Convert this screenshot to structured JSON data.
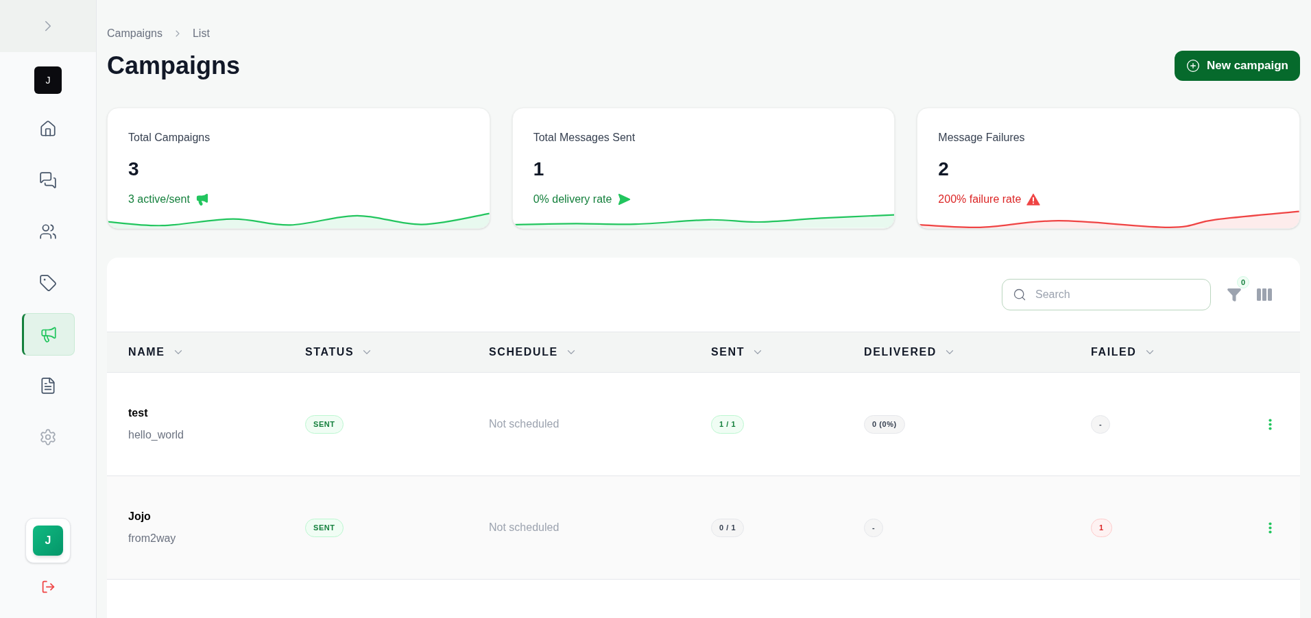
{
  "sidebar": {
    "workspace": {
      "initial": "J"
    },
    "nav": [
      {
        "selected": false,
        "disabled": false
      },
      {
        "selected": false,
        "disabled": false
      },
      {
        "selected": false,
        "disabled": false
      },
      {
        "selected": false,
        "disabled": false
      },
      {
        "selected": true,
        "disabled": false
      },
      {
        "selected": false,
        "disabled": false
      },
      {
        "selected": false,
        "disabled": true
      }
    ],
    "user": {
      "initial": "J"
    }
  },
  "breadcrumb": [
    {
      "label": "Campaigns"
    },
    {
      "label": "List"
    }
  ],
  "title": "Campaigns",
  "primary_action": {
    "label": "New campaign"
  },
  "stats": [
    {
      "label": "Total Campaigns",
      "value": "3",
      "note": "3 active/sent",
      "kind": "success"
    },
    {
      "label": "Total Messages Sent",
      "value": "1",
      "note": "0% delivery rate",
      "kind": "success"
    },
    {
      "label": "Message Failures",
      "value": "2",
      "note": "200% failure rate",
      "kind": "danger"
    }
  ],
  "table": {
    "search": {
      "placeholder": "Search"
    },
    "filter_count": "0",
    "columns": [
      {
        "label": "NAME"
      },
      {
        "label": "STATUS"
      },
      {
        "label": "SCHEDULE"
      },
      {
        "label": "SENT"
      },
      {
        "label": "DELIVERED"
      },
      {
        "label": "FAILED"
      }
    ],
    "rows": [
      {
        "name": "test",
        "template": "hello_world",
        "status": {
          "text": "SENT",
          "kind": "success"
        },
        "schedule": "Not scheduled",
        "sent": {
          "text": "1 / 1",
          "kind": "success"
        },
        "delivered": {
          "text": "0 (0%)",
          "kind": "neutral"
        },
        "failed": {
          "text": "-",
          "kind": "neutral"
        }
      },
      {
        "name": "Jojo",
        "template": "from2way",
        "status": {
          "text": "SENT",
          "kind": "success"
        },
        "schedule": "Not scheduled",
        "sent": {
          "text": "0 / 1",
          "kind": "neutral"
        },
        "delivered": {
          "text": "-",
          "kind": "neutral"
        },
        "failed": {
          "text": "1",
          "kind": "danger"
        }
      }
    ]
  }
}
